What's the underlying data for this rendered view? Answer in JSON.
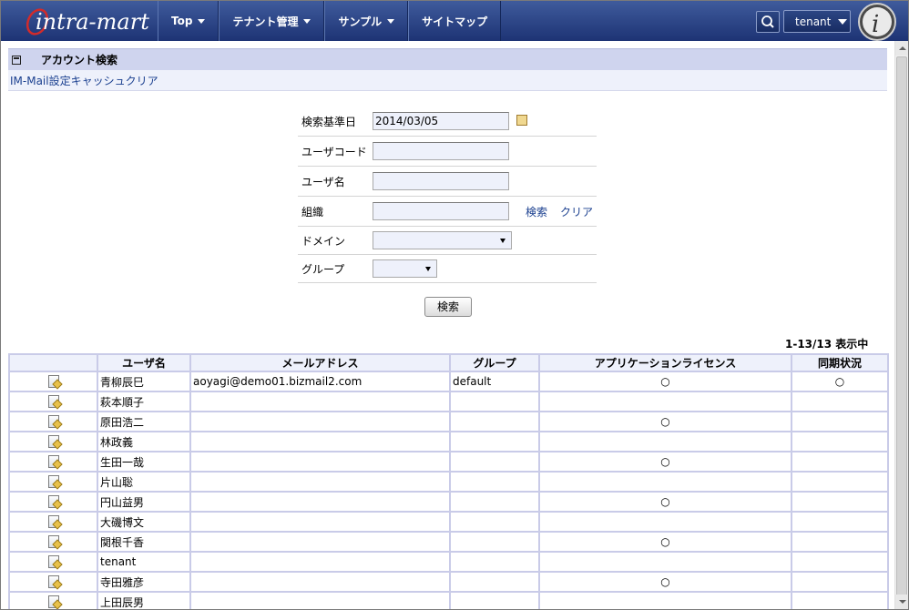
{
  "header": {
    "logo_text": "intra-mart",
    "nav": [
      {
        "label": "Top",
        "has_caret": true
      },
      {
        "label": "テナント管理",
        "has_caret": true
      },
      {
        "label": "サンプル",
        "has_caret": true
      },
      {
        "label": "サイトマップ",
        "has_caret": false
      }
    ],
    "user_label": "tenant",
    "search_icon": "search-icon",
    "brand_color": "#2a4484"
  },
  "page": {
    "title": "アカウント検索",
    "sub_link": "IM-Mail設定キャッシュクリア"
  },
  "form": {
    "date_label": "検索基準日",
    "date_value": "2014/03/05",
    "user_code_label": "ユーザコード",
    "user_code_value": "",
    "user_name_label": "ユーザ名",
    "user_name_value": "",
    "org_label": "組織",
    "org_value": "",
    "org_search_link": "検索",
    "org_clear_link": "クリア",
    "domain_label": "ドメイン",
    "domain_value": "",
    "group_label": "グループ",
    "group_value": "",
    "search_button": "検索"
  },
  "result_count": "1-13/13 表示中",
  "table": {
    "columns": [
      "",
      "ユーザ名",
      "メールアドレス",
      "グループ",
      "アプリケーションライセンス",
      "同期状況"
    ],
    "rows": [
      {
        "name": "青柳辰巳",
        "email": "aoyagi@demo01.bizmail2.com",
        "group": "default",
        "license": "○",
        "sync": "○"
      },
      {
        "name": "萩本順子",
        "email": "",
        "group": "",
        "license": "",
        "sync": ""
      },
      {
        "name": "原田浩二",
        "email": "",
        "group": "",
        "license": "○",
        "sync": ""
      },
      {
        "name": "林政義",
        "email": "",
        "group": "",
        "license": "",
        "sync": ""
      },
      {
        "name": "生田一哉",
        "email": "",
        "group": "",
        "license": "○",
        "sync": ""
      },
      {
        "name": "片山聡",
        "email": "",
        "group": "",
        "license": "",
        "sync": ""
      },
      {
        "name": "円山益男",
        "email": "",
        "group": "",
        "license": "○",
        "sync": ""
      },
      {
        "name": "大磯博文",
        "email": "",
        "group": "",
        "license": "",
        "sync": ""
      },
      {
        "name": "関根千香",
        "email": "",
        "group": "",
        "license": "○",
        "sync": ""
      },
      {
        "name": "tenant",
        "email": "",
        "group": "",
        "license": "",
        "sync": ""
      },
      {
        "name": "寺田雅彦",
        "email": "",
        "group": "",
        "license": "○",
        "sync": ""
      },
      {
        "name": "上田辰男",
        "email": "",
        "group": "",
        "license": "",
        "sync": ""
      }
    ]
  }
}
